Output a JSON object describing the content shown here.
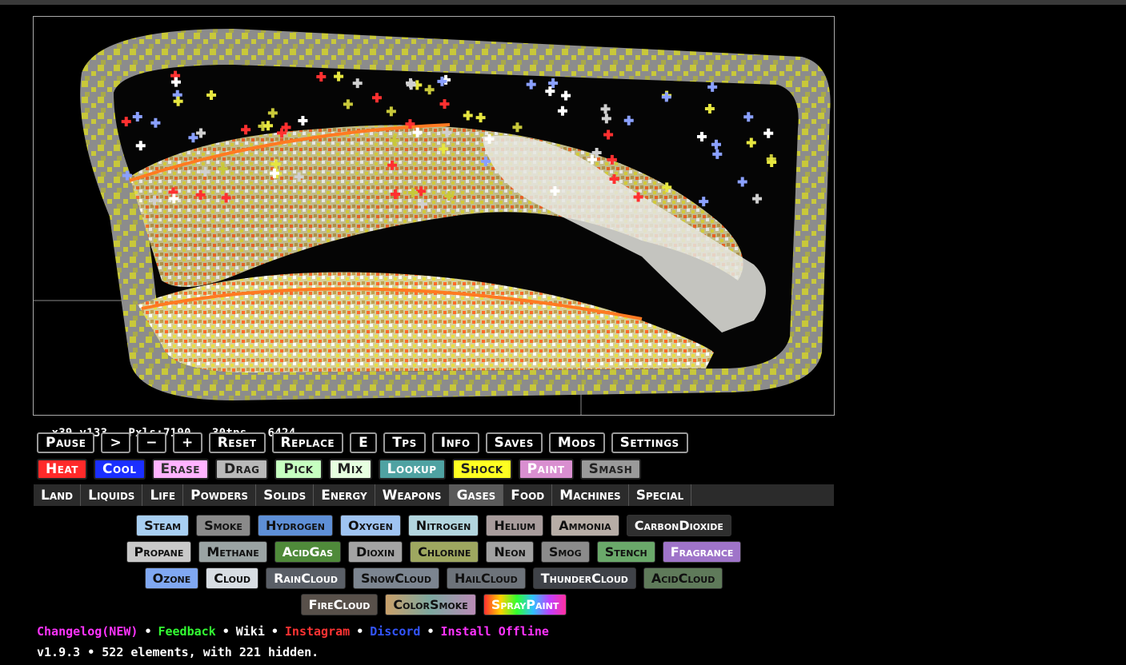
{
  "stats": {
    "coords": "x39,y133",
    "pixels": "Pxls:7190",
    "tps": "30tps",
    "ticks": "6424"
  },
  "controls": [
    {
      "id": "pause",
      "label": "Pause"
    },
    {
      "id": "step",
      "label": ">"
    },
    {
      "id": "minus",
      "label": "−"
    },
    {
      "id": "plus",
      "label": "+"
    },
    {
      "id": "reset",
      "label": "Reset"
    },
    {
      "id": "replace",
      "label": "Replace"
    },
    {
      "id": "e",
      "label": "E"
    },
    {
      "id": "tps",
      "label": "Tps"
    },
    {
      "id": "info",
      "label": "Info"
    },
    {
      "id": "saves",
      "label": "Saves"
    },
    {
      "id": "mods",
      "label": "Mods"
    },
    {
      "id": "settings",
      "label": "Settings"
    }
  ],
  "tools": [
    {
      "id": "heat",
      "label": "Heat",
      "bg": "#ff2a2a",
      "fg": "#ffffff"
    },
    {
      "id": "cool",
      "label": "Cool",
      "bg": "#1b2fff",
      "fg": "#ffffff"
    },
    {
      "id": "erase",
      "label": "Erase",
      "bg": "#ffb3ff",
      "fg": "#333333"
    },
    {
      "id": "drag",
      "label": "Drag",
      "bg": "#b9b9b9",
      "fg": "#222222"
    },
    {
      "id": "pick",
      "label": "Pick",
      "bg": "#c6ffc0",
      "fg": "#222222"
    },
    {
      "id": "mix",
      "label": "Mix",
      "bg": "#e6ffe0",
      "fg": "#222222"
    },
    {
      "id": "lookup",
      "label": "Lookup",
      "bg": "#4fa2a2",
      "fg": "#ffffff"
    },
    {
      "id": "shock",
      "label": "Shock",
      "bg": "#ffff22",
      "fg": "#222222"
    },
    {
      "id": "paint",
      "label": "Paint",
      "bg": "#d98fd0",
      "fg": "#ffffff"
    },
    {
      "id": "smash",
      "label": "Smash",
      "bg": "#9a9a9a",
      "fg": "#222222"
    }
  ],
  "categories": [
    {
      "id": "land",
      "label": "Land"
    },
    {
      "id": "liquids",
      "label": "Liquids"
    },
    {
      "id": "life",
      "label": "Life"
    },
    {
      "id": "powders",
      "label": "Powders"
    },
    {
      "id": "solids",
      "label": "Solids"
    },
    {
      "id": "energy",
      "label": "Energy"
    },
    {
      "id": "weapons",
      "label": "Weapons"
    },
    {
      "id": "gases",
      "label": "Gases",
      "active": true
    },
    {
      "id": "food",
      "label": "Food"
    },
    {
      "id": "machines",
      "label": "Machines"
    },
    {
      "id": "special",
      "label": "Special"
    }
  ],
  "elements": [
    [
      {
        "label": "Steam",
        "bg": "#a8cff2"
      },
      {
        "label": "Smoke",
        "bg": "#8a8a8a"
      },
      {
        "label": "Hydrogen",
        "bg": "#5e8fd6"
      },
      {
        "label": "Oxygen",
        "bg": "#9fc4f2"
      },
      {
        "label": "Nitrogen",
        "bg": "#b2d5de"
      },
      {
        "label": "Helium",
        "bg": "#a89c9c"
      },
      {
        "label": "Ammonia",
        "bg": "#b7ada6"
      },
      {
        "label": "CarbonDioxide",
        "bg": "#2f2f2f",
        "fg": "#ffffff"
      }
    ],
    [
      {
        "label": "Propane",
        "bg": "#c9c9c9"
      },
      {
        "label": "Methane",
        "bg": "#9aa3a3"
      },
      {
        "label": "AcidGas",
        "bg": "#4f8a3a",
        "fg": "#ffffff"
      },
      {
        "label": "Dioxin",
        "bg": "#a4a4a4"
      },
      {
        "label": "Chlorine",
        "bg": "#9ea760"
      },
      {
        "label": "Neon",
        "bg": "#a1a1a1"
      },
      {
        "label": "Smog",
        "bg": "#8b8b8b"
      },
      {
        "label": "Stench",
        "bg": "#6aa86a"
      },
      {
        "label": "Fragrance",
        "bg": "#9f74c9",
        "fg": "#ffffff"
      }
    ],
    [
      {
        "label": "Ozone",
        "bg": "#80a8f2"
      },
      {
        "label": "Cloud",
        "bg": "#d8dde3"
      },
      {
        "label": "RainCloud",
        "bg": "#5a5f67",
        "fg": "#ffffff"
      },
      {
        "label": "SnowCloud",
        "bg": "#7c8590"
      },
      {
        "label": "HailCloud",
        "bg": "#6d737a"
      },
      {
        "label": "ThunderCloud",
        "bg": "#3f4248",
        "fg": "#ffffff"
      },
      {
        "label": "AcidCloud",
        "bg": "#5f7a5a"
      }
    ],
    [
      {
        "label": "FireCloud",
        "bg": "#58504a",
        "fg": "#ffffff"
      },
      {
        "label": "ColorSmoke",
        "bg": "linear-gradient(90deg,#c9a06a,#7da8a0,#b98bb6)"
      },
      {
        "label": "SprayPaint",
        "bg": "linear-gradient(90deg,#ff3030,#ffd000,#30ff30,#30c0ff,#c040ff,#ff30a0)",
        "fg": "#ffffff"
      }
    ]
  ],
  "links": [
    {
      "label": "Changelog(NEW)",
      "color": "#ff33ff"
    },
    {
      "label": "Feedback",
      "color": "#33ff33"
    },
    {
      "label": "Wiki",
      "color": "#ffffff"
    },
    {
      "label": "Instagram",
      "color": "#ff3333"
    },
    {
      "label": "Discord",
      "color": "#3355ff"
    },
    {
      "label": "Install Offline",
      "color": "#ff33ff"
    }
  ],
  "version": "v1.9.3 • 522 elements, with 221 hidden.",
  "colors": {
    "border_gray": "#8c8c8c",
    "yellow": "#c8c83a",
    "sand_mix": "#d6cf9a"
  }
}
